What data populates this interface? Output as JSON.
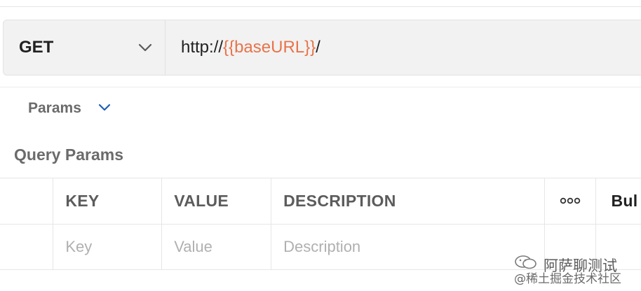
{
  "request": {
    "method": "GET",
    "url_prefix": "http://",
    "url_variable": "{{baseURL}}",
    "url_suffix": "/"
  },
  "tabs": {
    "params_label": "Params"
  },
  "query_params": {
    "title": "Query Params",
    "columns": [
      "KEY",
      "VALUE",
      "DESCRIPTION",
      "ooo",
      "Bul"
    ],
    "placeholders": {
      "key": "Key",
      "value": "Value",
      "description": "Description"
    }
  },
  "watermark": {
    "name": "阿萨聊测试",
    "sub": "@稀土掘金技术社区"
  },
  "colors": {
    "variable": "#e8744a",
    "chevron_blue": "#1f5fb5"
  }
}
